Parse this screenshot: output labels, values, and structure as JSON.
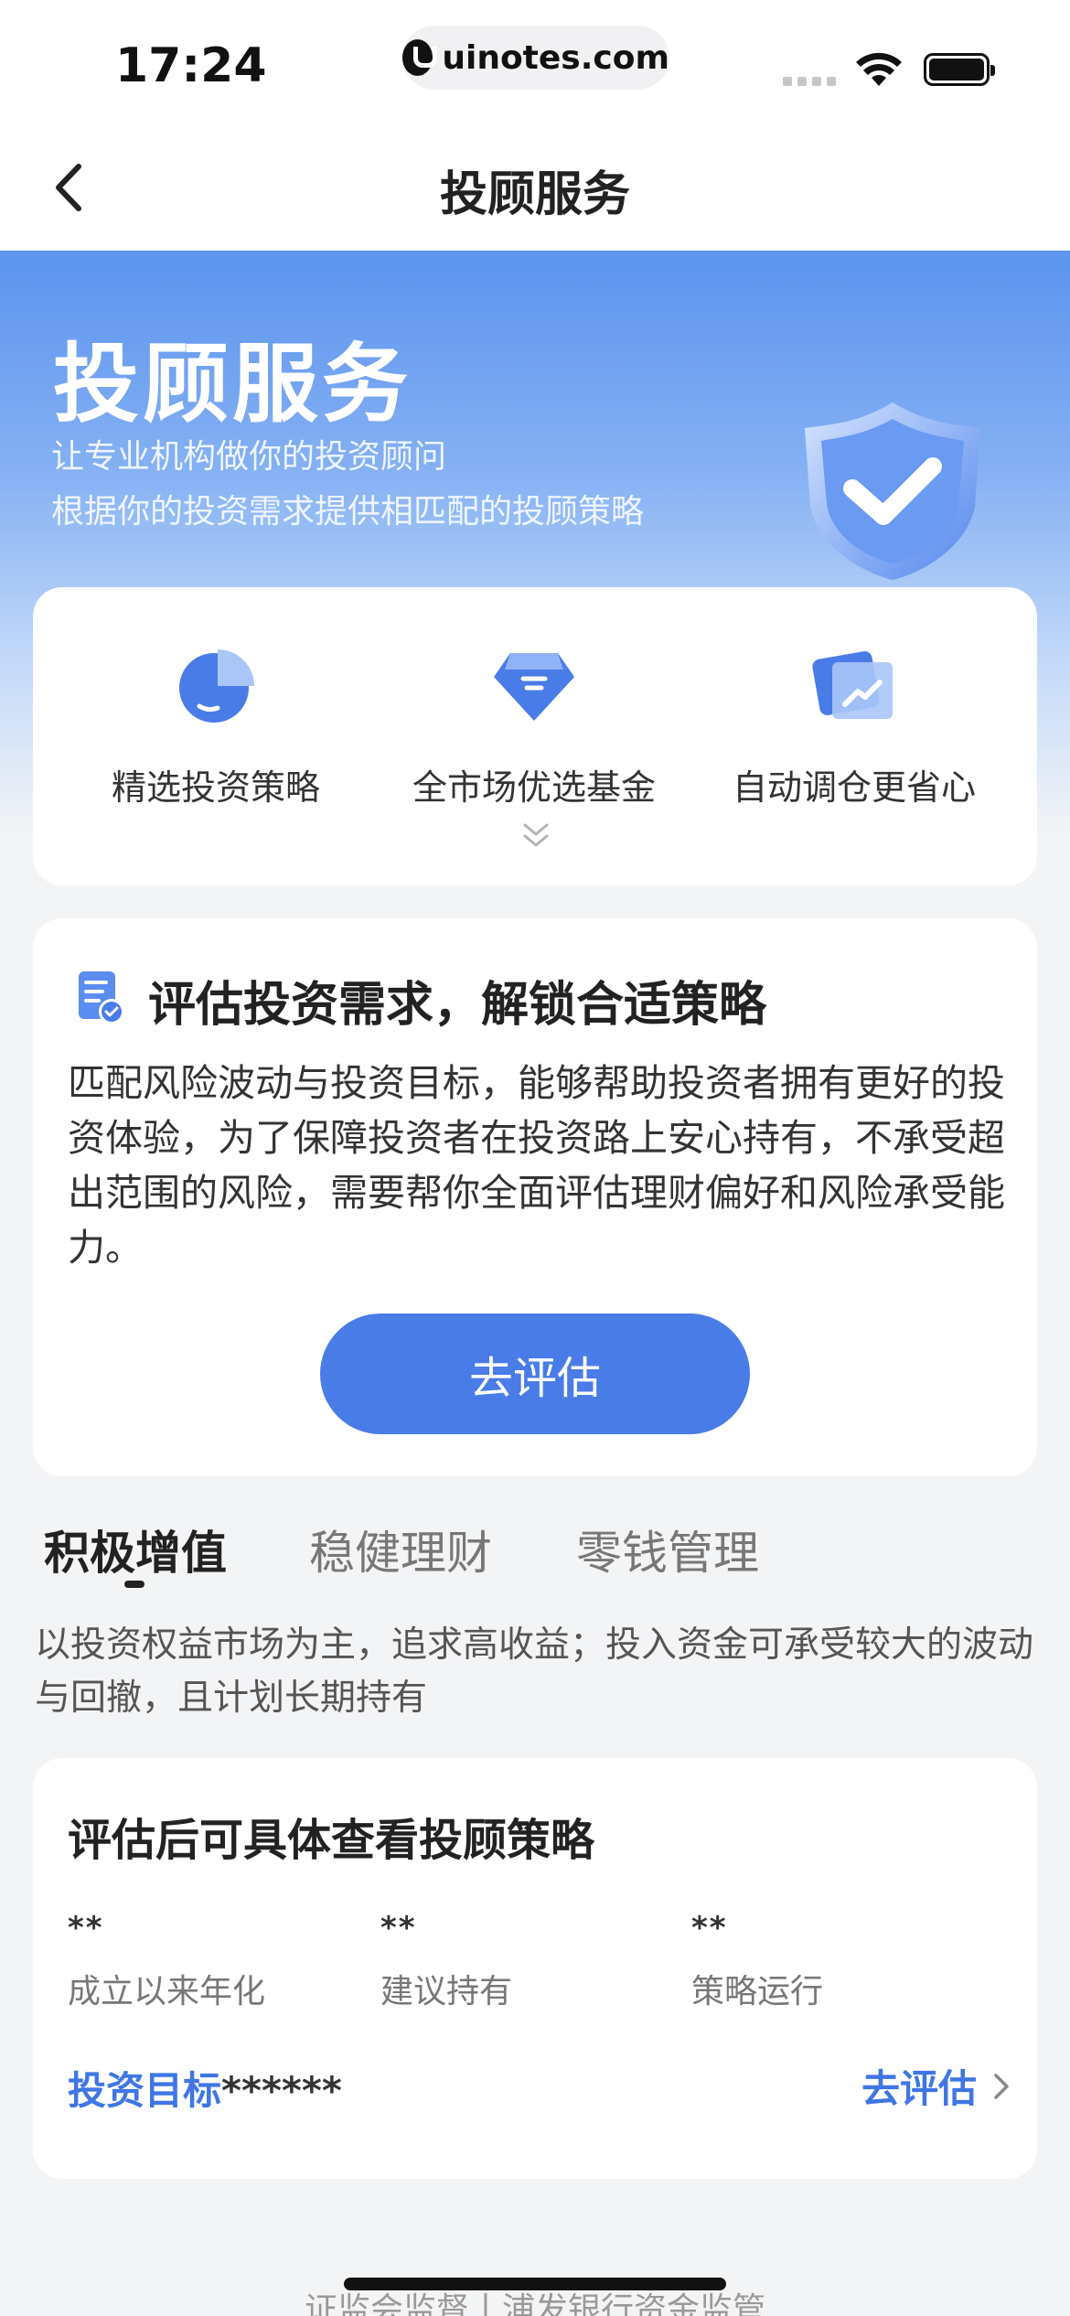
{
  "status_bar": {
    "time": "17:24",
    "url": "uinotes.com"
  },
  "nav": {
    "title": "投顾服务"
  },
  "hero": {
    "title": "投顾服务",
    "subtitle_line1": "让专业机构做你的投资顾问",
    "subtitle_line2": "根据你的投资需求提供相匹配的投顾策略"
  },
  "features": [
    {
      "label": "精选投资策略",
      "icon": "pie-chart-icon"
    },
    {
      "label": "全市场优选基金",
      "icon": "diamond-icon"
    },
    {
      "label": "自动调仓更省心",
      "icon": "trend-chart-icon"
    }
  ],
  "assessment": {
    "title": "评估投资需求，解锁合适策略",
    "body": "匹配风险波动与投资目标，能够帮助投资者拥有更好的投资体验，为了保障投资者在投资路上安心持有，不承受超出范围的风险，需要帮你全面评估理财偏好和风险承受能力。",
    "button_label": "去评估"
  },
  "tabs": [
    {
      "label": "积极增值",
      "active": true
    },
    {
      "label": "稳健理财",
      "active": false
    },
    {
      "label": "零钱管理",
      "active": false
    }
  ],
  "tab_description": "以投资权益市场为主，追求高收益；投入资金可承受较大的波动与回撤，且计划长期持有",
  "strategy_card": {
    "title": "评估后可具体查看投顾策略",
    "metrics": [
      {
        "value": "**",
        "label": "成立以来年化"
      },
      {
        "value": "**",
        "label": "建议持有"
      },
      {
        "value": "**",
        "label": "策略运行"
      }
    ],
    "goal_label": "投资目标",
    "goal_value": "******",
    "action_label": "去评估"
  },
  "footer": {
    "text": "证监会监督丨浦发银行资金监管"
  },
  "colors": {
    "accent": "#4a7ce7",
    "link": "#3f76e4",
    "hero_top": "#5b93ee",
    "page_bg": "#f3f4f6"
  }
}
